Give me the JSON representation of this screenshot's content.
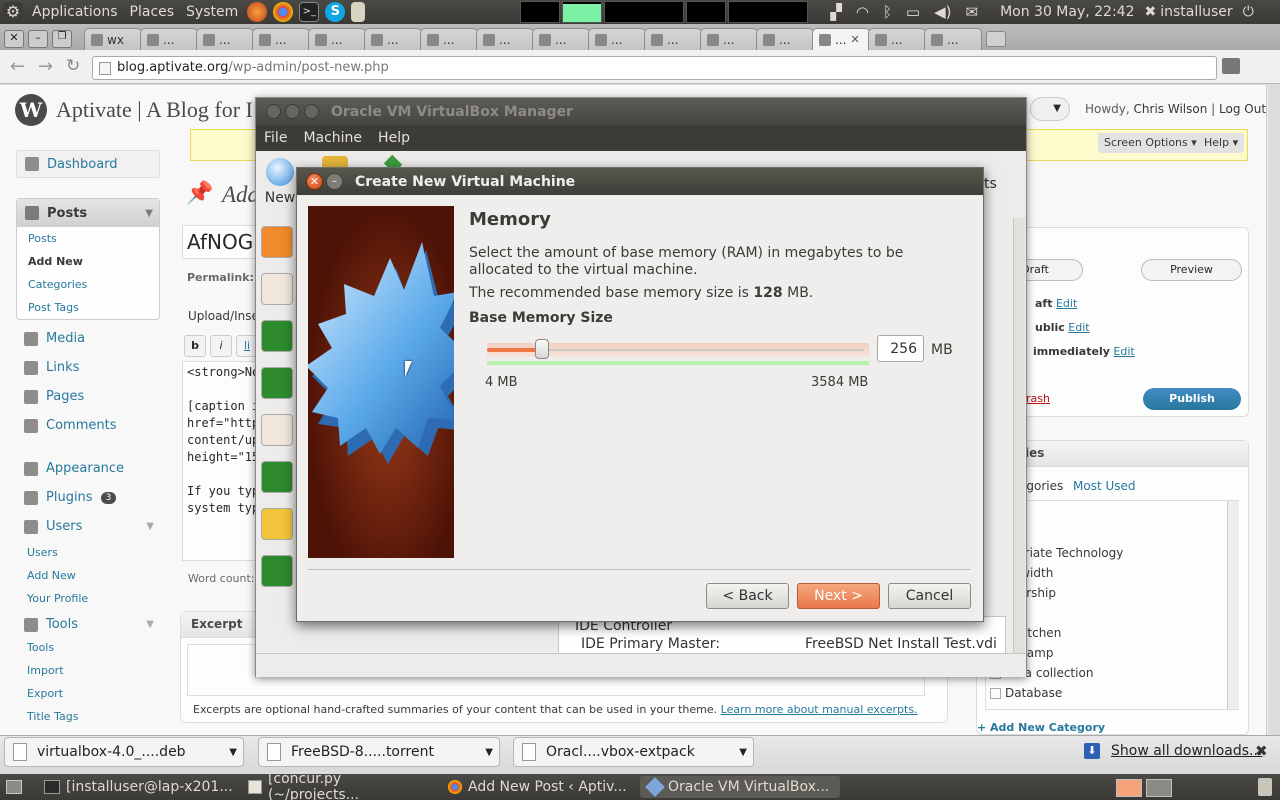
{
  "top_panel": {
    "menus": [
      "Applications",
      "Places",
      "System"
    ],
    "clock": "Mon 30 May, 22:42",
    "user": "installuser"
  },
  "browser": {
    "tabs": [
      {
        "label": "wx",
        "active": false
      },
      {
        "label": "...",
        "active": false
      },
      {
        "label": "...",
        "active": false
      },
      {
        "label": "...",
        "active": false
      },
      {
        "label": "...",
        "active": false
      },
      {
        "label": "...",
        "active": false
      },
      {
        "label": "...",
        "active": false
      },
      {
        "label": "...",
        "active": false
      },
      {
        "label": "...",
        "active": false
      },
      {
        "label": "...",
        "active": false
      },
      {
        "label": "...",
        "active": false
      },
      {
        "label": "...",
        "active": false
      },
      {
        "label": "...",
        "active": false
      },
      {
        "label": "...",
        "active": true
      },
      {
        "label": "...",
        "active": false
      },
      {
        "label": "...",
        "active": false
      }
    ],
    "url_host": "blog.aptivate.org",
    "url_path": "/wp-admin/post-new.php"
  },
  "wordpress": {
    "site_title": "Aptivate | A Blog for I",
    "greeting_prefix": "Howdy,",
    "user_name": "Chris Wilson",
    "logout": "Log Out",
    "screen_options": "Screen Options",
    "help": "Help",
    "page_title": "Add",
    "post_title_value": "AfNOG",
    "permalink_label": "Permalink: ht",
    "upload_insert": "Upload/Inse",
    "editor_buttons": [
      "b",
      "i",
      "li"
    ],
    "editor_lines": [
      "<strong>Ne",
      "",
      "[caption id=",
      "href=\"http:/",
      "content/uplo",
      "height=\"150",
      "",
      "If you type",
      "system type"
    ],
    "word_count": "Word count: 3",
    "excerpt_title": "Excerpt",
    "excerpt_note": "Excerpts are optional hand-crafted summaries of your content that can be used in your theme.",
    "excerpt_link": "Learn more about manual excerpts.",
    "nav": {
      "dashboard": "Dashboard",
      "posts": "Posts",
      "posts_sub": [
        "Posts",
        "Add New",
        "Categories",
        "Post Tags"
      ],
      "media": "Media",
      "links": "Links",
      "pages": "Pages",
      "comments": "Comments",
      "appearance": "Appearance",
      "plugins": "Plugins",
      "plugins_badge": "3",
      "users": "Users",
      "users_sub": [
        "Users",
        "Add New",
        "Your Profile"
      ],
      "tools": "Tools",
      "tools_sub": [
        "Tools",
        "Import",
        "Export",
        "Title Tags"
      ]
    },
    "publish_box": {
      "save_draft": "Draft",
      "preview": "Preview",
      "status_text": "aft",
      "visibility_text": "ublic",
      "schedule_text": "immediately",
      "edit": "Edit",
      "trash": "rash",
      "publish": "Publish"
    },
    "categories_box": {
      "title": "ies",
      "tab_all": "egories",
      "tab_most_used": "Most Used",
      "items": [
        "ca",
        "e",
        "ropriate Technology",
        "ndwidth",
        "nsorship",
        "S",
        "e Kitchen",
        "is Camp",
        "data collection",
        "Database"
      ],
      "add_new": "+ Add New Category"
    }
  },
  "vbox_manager": {
    "title": "Oracle VM VirtualBox Manager",
    "menus": [
      "File",
      "Machine",
      "Help"
    ],
    "toolbar_new": "New",
    "right_tab_fragment": "ts",
    "details_controller": "IDE Controller",
    "details_master_label": "IDE Primary Master:",
    "details_master_value": "FreeBSD Net Install Test.vdi"
  },
  "dialog": {
    "title": "Create New Virtual Machine",
    "heading": "Memory",
    "description": "Select the amount of base memory (RAM) in megabytes to be allocated to the virtual machine.",
    "recommended_prefix": "The recommended base memory size is",
    "recommended_value": "128",
    "recommended_suffix": "MB.",
    "field_label": "Base Memory Size",
    "slider": {
      "value_mb": 256,
      "min_mb": 4,
      "max_mb": 3584,
      "recommended_mb": 128
    },
    "spin_value": "256",
    "unit": "MB",
    "min_label": "4 MB",
    "max_label": "3584 MB",
    "back": "< Back",
    "next": "Next >",
    "cancel": "Cancel"
  },
  "downloads": {
    "items": [
      "virtualbox-4.0_....deb",
      "FreeBSD-8.....torrent",
      "Oracl....vbox-extpack"
    ],
    "show_all": "Show all downloads..."
  },
  "taskbar": {
    "items": [
      "[installuser@lap-x201...",
      "[concur.py (~/projects...",
      "Add New Post ‹ Aptiv...",
      "Oracle VM VirtualBox..."
    ]
  },
  "colors": {
    "panel": "#3c3b37",
    "wp_link": "#21759b",
    "ubuntu_orange": "#e9784a",
    "publish_blue": "#2a6fa8"
  }
}
